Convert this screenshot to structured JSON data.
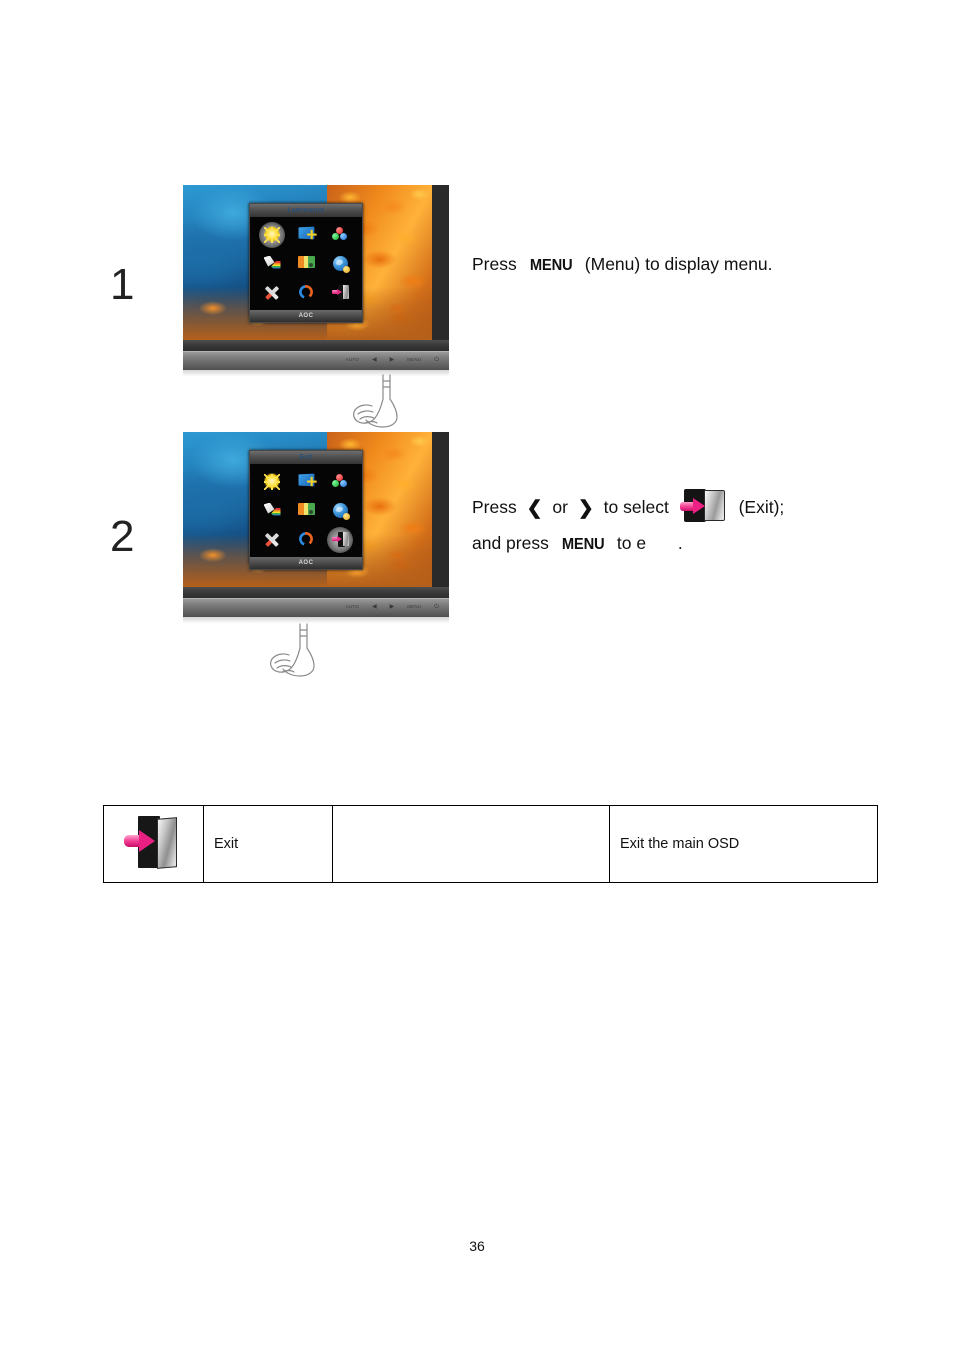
{
  "page": {
    "number": "36"
  },
  "steps": [
    {
      "number": "1",
      "monitor": {
        "osd_title": "Luminance",
        "osd_brand": "AOC",
        "buttons": [
          {
            "label": "AUTO",
            "glyph": ""
          },
          {
            "label": "",
            "glyph": "◀"
          },
          {
            "label": "",
            "glyph": "▶"
          },
          {
            "label": "MENU",
            "glyph": ""
          },
          {
            "label": "",
            "glyph": "⏻"
          }
        ],
        "icons": [
          {
            "name": "luminance-icon",
            "selected": true
          },
          {
            "name": "image-setup-icon",
            "selected": false
          },
          {
            "name": "color-setup-icon",
            "selected": false
          },
          {
            "name": "picture-boost-icon",
            "selected": false
          },
          {
            "name": "osd-setup-icon",
            "selected": false
          },
          {
            "name": "extra-icon",
            "selected": false
          },
          {
            "name": "tools-icon",
            "selected": false
          },
          {
            "name": "reset-icon",
            "selected": false
          },
          {
            "name": "exit-icon",
            "selected": false
          }
        ]
      },
      "instruction": {
        "lines": [
          {
            "parts": [
              {
                "type": "text",
                "value": "Press"
              },
              {
                "type": "menu",
                "value": "MENU"
              },
              {
                "type": "text",
                "value": "(Menu) to display menu."
              }
            ]
          }
        ]
      }
    },
    {
      "number": "2",
      "monitor": {
        "osd_title": "Exit",
        "osd_brand": "AOC",
        "buttons": [
          {
            "label": "AUTO",
            "glyph": ""
          },
          {
            "label": "",
            "glyph": "◀"
          },
          {
            "label": "",
            "glyph": "▶"
          },
          {
            "label": "MENU",
            "glyph": ""
          },
          {
            "label": "",
            "glyph": "⏻"
          }
        ],
        "icons": [
          {
            "name": "luminance-icon",
            "selected": false
          },
          {
            "name": "image-setup-icon",
            "selected": false
          },
          {
            "name": "color-setup-icon",
            "selected": false
          },
          {
            "name": "picture-boost-icon",
            "selected": false
          },
          {
            "name": "osd-setup-icon",
            "selected": false
          },
          {
            "name": "extra-icon",
            "selected": false
          },
          {
            "name": "tools-icon",
            "selected": false
          },
          {
            "name": "reset-icon",
            "selected": false
          },
          {
            "name": "exit-icon",
            "selected": true
          }
        ]
      },
      "instruction": {
        "lines": [
          {
            "parts": [
              {
                "type": "text",
                "value": "Press"
              },
              {
                "type": "chevron",
                "value": "❮"
              },
              {
                "type": "text",
                "value": "or"
              },
              {
                "type": "chevron",
                "value": "❯"
              },
              {
                "type": "text",
                "value": "to select"
              },
              {
                "type": "exit-icon",
                "value": ""
              },
              {
                "type": "text",
                "value": "(Exit);"
              }
            ]
          },
          {
            "parts": [
              {
                "type": "text",
                "value": "and press"
              },
              {
                "type": "menu",
                "value": "MENU"
              },
              {
                "type": "text",
                "value": "to e"
              },
              {
                "type": "text",
                "value": "."
              }
            ]
          }
        ]
      }
    }
  ],
  "table": {
    "rows": [
      {
        "icon": "exit-icon",
        "name": "Exit",
        "middle": "",
        "description": "Exit the main OSD"
      }
    ]
  }
}
